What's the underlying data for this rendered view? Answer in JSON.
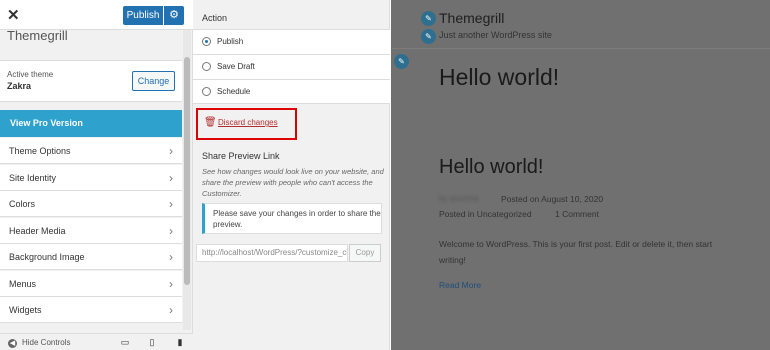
{
  "sidebar": {
    "close_label": "✕",
    "publish_label": "Publish",
    "gear_label": "⚙",
    "site_title_partial": "Themegrill",
    "active_theme_label": "Active theme",
    "active_theme_name": "Zakra",
    "change_label": "Change",
    "pro_label": "View Pro Version",
    "items": [
      {
        "label": "Theme Options"
      },
      {
        "label": "Site Identity"
      },
      {
        "label": "Colors"
      },
      {
        "label": "Header Media"
      },
      {
        "label": "Background Image"
      },
      {
        "label": "Menus"
      },
      {
        "label": "Widgets"
      }
    ],
    "hide_controls_label": "Hide Controls",
    "icons": [
      "close-icon",
      "gear-icon",
      "chevron-right-icon",
      "desktop-icon",
      "tablet-icon",
      "mobile-icon"
    ]
  },
  "panel": {
    "action_title": "Action",
    "options": [
      {
        "label": "Publish",
        "checked": true
      },
      {
        "label": "Save Draft",
        "checked": false
      },
      {
        "label": "Schedule",
        "checked": false
      }
    ],
    "discard_label": "Discard changes",
    "share_title": "Share Preview Link",
    "share_desc": "See how changes would look live on your website, and share the preview with people who can't access the Customizer.",
    "notice": "Please save your changes in order to share the preview.",
    "url": "http://localhost/WordPress/?customize_changeset_uuid",
    "copy_label": "Copy"
  },
  "preview": {
    "site_title": "Themegrill",
    "tagline": "Just another WordPress site",
    "hero_title": "Hello world!",
    "post_title": "Hello world!",
    "author": "by arunima",
    "date_text": "Posted on August 10, 2020",
    "posted_in": "Posted in Uncategorized",
    "comments": "1 Comment",
    "excerpt": "Welcome to WordPress. This is your first post. Edit or delete it, then start writing!",
    "read_more": "Read More"
  },
  "colors": {
    "accent": "#2271b1",
    "pro": "#2ea2cc",
    "danger": "#b32d2e",
    "overlay": "#707070"
  }
}
